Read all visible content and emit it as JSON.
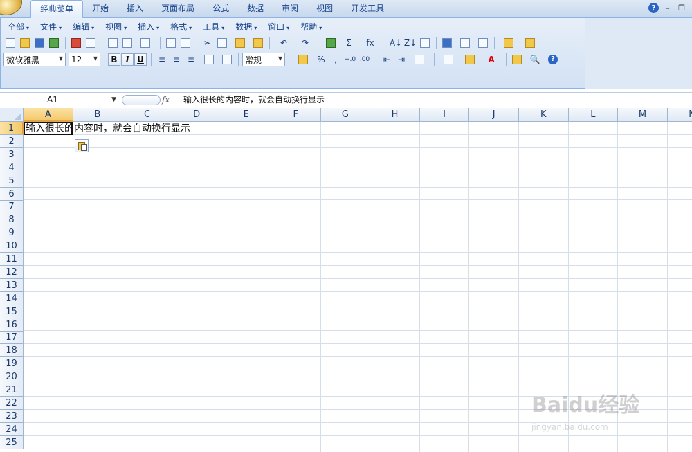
{
  "tabs": [
    {
      "label": "经典菜单",
      "active": true
    },
    {
      "label": "开始",
      "active": false
    },
    {
      "label": "插入",
      "active": false
    },
    {
      "label": "页面布局",
      "active": false
    },
    {
      "label": "公式",
      "active": false
    },
    {
      "label": "数据",
      "active": false
    },
    {
      "label": "审阅",
      "active": false
    },
    {
      "label": "视图",
      "active": false
    },
    {
      "label": "开发工具",
      "active": false
    }
  ],
  "window_controls": {
    "help": "?",
    "minimize": "–",
    "restore": "❐"
  },
  "menus": [
    "全部",
    "文件",
    "编辑",
    "视图",
    "插入",
    "格式",
    "工具",
    "数据",
    "窗口",
    "帮助"
  ],
  "format_bar": {
    "font": "微软雅黑",
    "size": "12",
    "bold": "B",
    "italic": "I",
    "underline": "U",
    "number_format": "常规",
    "percent": "%",
    "comma": ",",
    "inc_decimal": "+.0",
    "dec_decimal": ".00"
  },
  "toolbar_glyphs": {
    "sigma": "Σ",
    "fx": "fx",
    "sort_az": "A↓",
    "sort_za": "Z↓"
  },
  "formula_bar": {
    "name_box": "A1",
    "fx_label": "fx",
    "content": "输入很长的内容时，就会自动换行显示"
  },
  "columns": [
    "A",
    "B",
    "C",
    "D",
    "E",
    "F",
    "G",
    "H",
    "I",
    "J",
    "K",
    "L",
    "M",
    "N"
  ],
  "rows": [
    "1",
    "2",
    "3",
    "4",
    "5",
    "6",
    "7",
    "8",
    "9",
    "10",
    "11",
    "12",
    "13",
    "14",
    "15",
    "16",
    "17",
    "18",
    "19",
    "20",
    "21",
    "22",
    "23",
    "24",
    "25"
  ],
  "active_cell": {
    "ref": "A1",
    "value": "输入很长的内容时，就会自动换行显示"
  },
  "watermark": {
    "logo": "Baidu经验",
    "sub": "jingyan.baidu.com"
  },
  "colors": {
    "selected_header": "#f4c86a",
    "ribbon_bg": "#d2e1f4",
    "grid_line": "#d4dde8"
  }
}
